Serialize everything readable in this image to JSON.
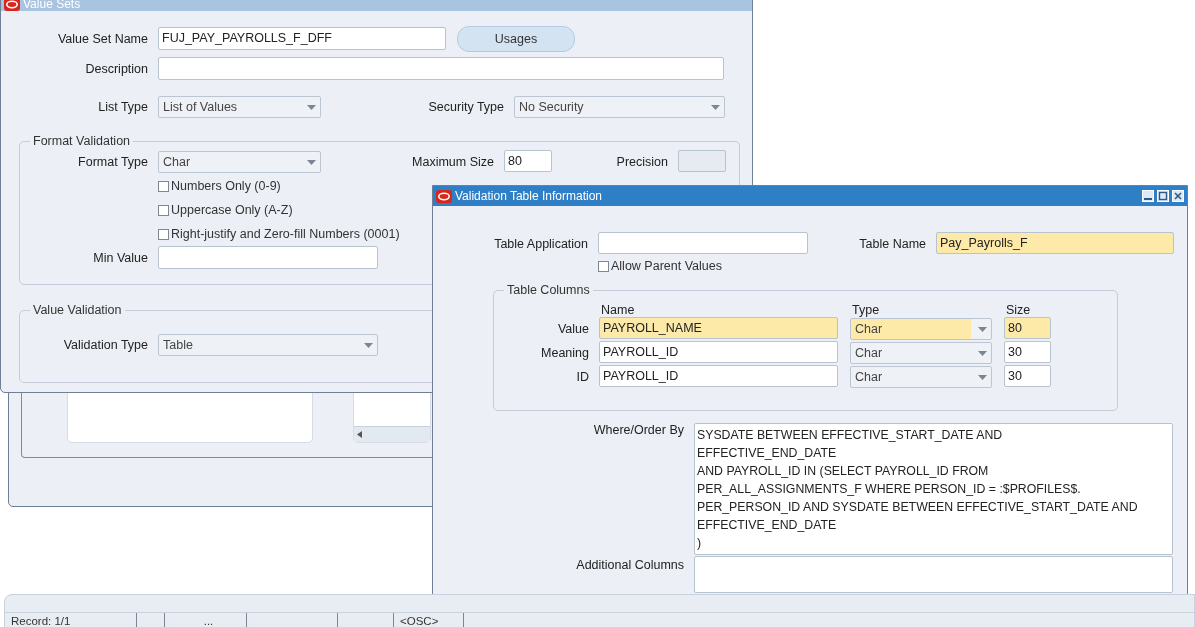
{
  "value_sets_window": {
    "title": "Value Sets",
    "value_set_name": {
      "label": "Value Set Name",
      "value": "FUJ_PAY_PAYROLLS_F_DFF"
    },
    "usages_button": {
      "label": "Usages"
    },
    "description": {
      "label": "Description"
    },
    "list_type": {
      "label": "List Type",
      "value": "List of Values"
    },
    "security_type": {
      "label": "Security Type",
      "value": "No Security"
    },
    "format_validation": {
      "title": "Format Validation",
      "format_type": {
        "label": "Format Type",
        "value": "Char"
      },
      "maximum_size": {
        "label": "Maximum Size",
        "value": "80"
      },
      "precision": {
        "label": "Precision",
        "disabled": true
      },
      "options": [
        {
          "label": "Numbers Only (0-9)",
          "checked": false
        },
        {
          "label": "Uppercase Only (A-Z)",
          "checked": false
        },
        {
          "label": "Right-justify and Zero-fill Numbers (0001)",
          "checked": false
        }
      ],
      "min_value": {
        "label": "Min Value"
      }
    },
    "value_validation": {
      "title": "Value Validation",
      "validation_type": {
        "label": "Validation Type",
        "value": "Table"
      }
    }
  },
  "validation_table_window": {
    "title": "Validation Table Information",
    "table_application": {
      "label": "Table Application",
      "required": false
    },
    "allow_parent_values": {
      "label": "Allow Parent Values",
      "checked": false
    },
    "table_name": {
      "label": "Table Name",
      "value": "Pay_Payrolls_F",
      "required": true
    },
    "table_columns": {
      "title": "Table Columns",
      "headers": [
        "Name",
        "Type",
        "Size"
      ],
      "rows": [
        {
          "label": "Value",
          "name": "PAYROLL_NAME",
          "type": "Char",
          "size": "80",
          "required": true
        },
        {
          "label": "Meaning",
          "name": "PAYROLL_ID",
          "type": "Char",
          "size": "30",
          "required": false
        },
        {
          "label": "ID",
          "name": "PAYROLL_ID",
          "type": "Char",
          "size": "30",
          "required": false
        }
      ]
    },
    "where_order_by": {
      "label": "Where/Order By",
      "value": "SYSDATE BETWEEN EFFECTIVE_START_DATE AND\nEFFECTIVE_END_DATE\nAND PAYROLL_ID IN (SELECT PAYROLL_ID FROM\nPER_ALL_ASSIGNMENTS_F WHERE PERSON_ID = :$PROFILES$.\nPER_PERSON_ID AND SYSDATE BETWEEN EFFECTIVE_START_DATE AND\nEFFECTIVE_END_DATE\n)"
    },
    "additional_columns": {
      "label": "Additional Columns"
    }
  },
  "status_bar": {
    "record": "Record: 1/1",
    "indicator": "...",
    "mode": "<OSC>"
  }
}
